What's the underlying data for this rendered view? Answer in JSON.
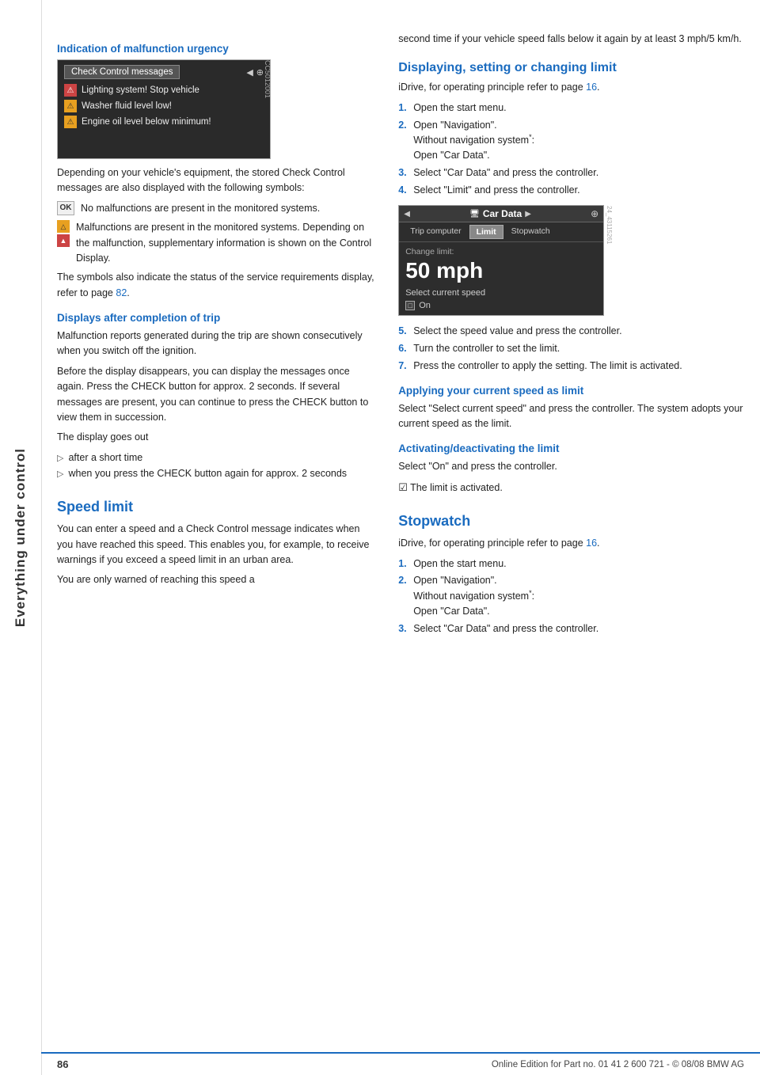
{
  "sidebar": {
    "text": "Everything under control"
  },
  "footer": {
    "page_number": "86",
    "copyright": "Online Edition for Part no. 01 41 2 600 721 - © 08/08 BMW AG"
  },
  "left_column": {
    "section1": {
      "heading": "Indication of malfunction urgency",
      "check_control": {
        "title": "Check Control messages",
        "rows": [
          "Lighting system! Stop vehicle",
          "Washer fluid level low!",
          "Engine oil level below minimum!"
        ]
      },
      "body1": "Depending on your vehicle's equipment, the stored Check Control messages are also displayed with the following symbols:",
      "symbol1_label": "No malfunctions are present in the monitored systems.",
      "symbol2_label": "Malfunctions are present in the monitored systems. Depending on the malfunction, supplementary information is shown on the Control Display.",
      "body2": "The symbols also indicate the status of the service requirements display, refer to page",
      "page_ref_1": "82",
      "body2_end": "."
    },
    "section2": {
      "heading": "Displays after completion of trip",
      "body1": "Malfunction reports generated during the trip are shown consecutively when you switch off the ignition.",
      "body2": "Before the display disappears, you can display the messages once again. Press the CHECK button for approx. 2 seconds. If several messages are present, you can continue to press the CHECK button to view them in succession.",
      "display_goes": "The display goes out",
      "bullets": [
        "after a short time",
        "when you press the CHECK button again for approx. 2 seconds"
      ]
    },
    "section3": {
      "heading": "Speed limit",
      "body1": "You can enter a speed and a Check Control message indicates when you have reached this speed. This enables you, for example, to receive warnings if you exceed a speed limit in an urban area.",
      "body2": "You are only warned of reaching this speed a"
    }
  },
  "right_column": {
    "body_top": "second time if your vehicle speed falls below it again by at least 3 mph/5 km/h.",
    "section1": {
      "heading": "Displaying, setting or changing limit",
      "intro": "iDrive, for operating principle refer to page",
      "page_ref": "16",
      "intro_end": ".",
      "steps": [
        "Open the start menu.",
        "Open \"Navigation\". Without navigation system*: Open \"Car Data\".",
        "Select \"Car Data\" and press the controller.",
        "Select \"Limit\" and press the controller."
      ],
      "car_data_ui": {
        "title": "Car Data",
        "tabs": [
          "Trip computer",
          "Limit",
          "Stopwatch"
        ],
        "active_tab": "Limit",
        "change_limit_label": "Change limit:",
        "speed": "50 mph",
        "select_current_speed": "Select current speed",
        "checkbox_label": "On",
        "checkbox_checked": false
      },
      "steps2": [
        "Select the speed value and press the controller.",
        "Turn the controller to set the limit.",
        "Press the controller to apply the setting. The limit is activated."
      ]
    },
    "section2": {
      "heading": "Applying your current speed as limit",
      "body": "Select \"Select current speed\" and press the controller. The system adopts your current speed as the limit."
    },
    "section3": {
      "heading": "Activating/deactivating the limit",
      "body1": "Select \"On\" and press the controller.",
      "checkmark_text": "The limit is activated."
    },
    "section4": {
      "heading": "Stopwatch",
      "intro": "iDrive, for operating principle refer to page",
      "page_ref": "16",
      "intro_end": ".",
      "steps": [
        "Open the start menu.",
        "Open \"Navigation\". Without navigation system*: Open \"Car Data\".",
        "Select \"Car Data\" and press the controller."
      ]
    }
  }
}
